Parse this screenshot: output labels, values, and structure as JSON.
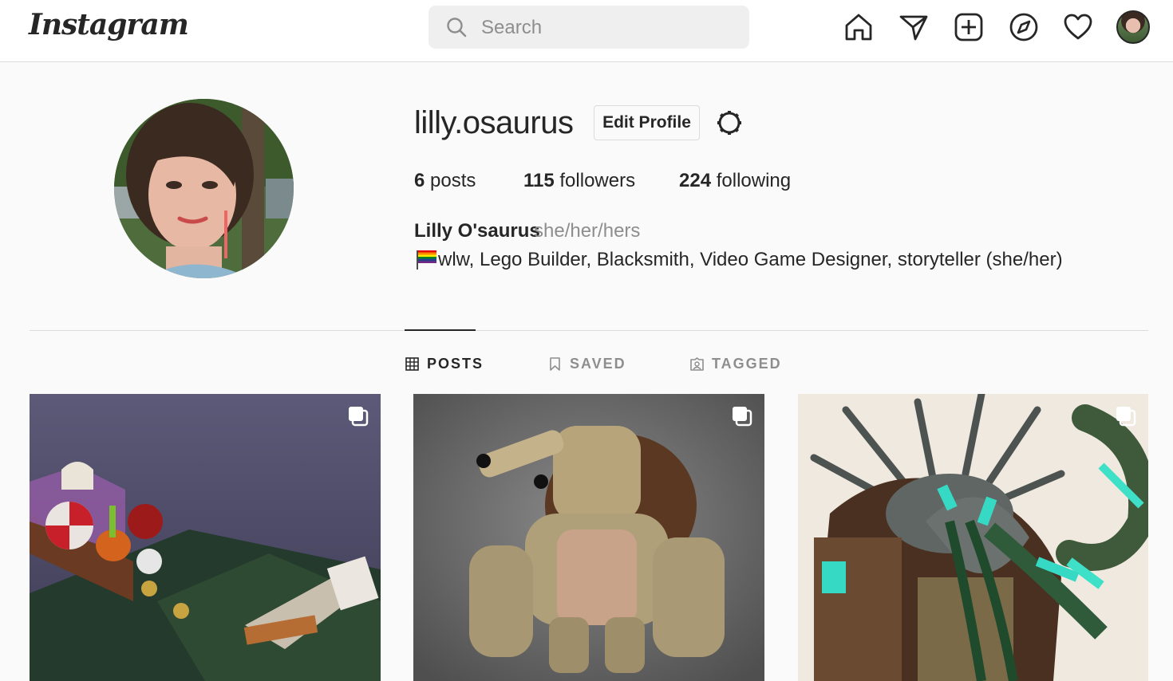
{
  "nav": {
    "logo": "Instagram",
    "search_placeholder": "Search",
    "icons": [
      "home-icon",
      "direct-message-icon",
      "new-post-icon",
      "explore-icon",
      "activity-heart-icon",
      "profile-avatar"
    ]
  },
  "profile": {
    "username": "lilly.osaurus",
    "edit_button": "Edit Profile",
    "stats": {
      "posts_count": "6",
      "posts_label": "posts",
      "followers_count": "115",
      "followers_label": "followers",
      "following_count": "224",
      "following_label": "following"
    },
    "full_name": "Lilly O'saurus",
    "pronouns": "she/her/hers",
    "bio_emoji": "rainbow-flag",
    "bio": "wlw, Lego Builder, Blacksmith, Video Game Designer, storyteller (she/her)"
  },
  "tabs": [
    {
      "label": "POSTS",
      "icon": "grid-icon",
      "active": true
    },
    {
      "label": "SAVED",
      "icon": "bookmark-icon",
      "active": false
    },
    {
      "label": "TAGGED",
      "icon": "tagged-icon",
      "active": false
    }
  ],
  "posts": [
    {
      "subject": "lego-bed-scene",
      "multiple": true
    },
    {
      "subject": "lego-tan-robot-creature",
      "multiple": true
    },
    {
      "subject": "lego-green-cyan-monster",
      "multiple": true
    }
  ],
  "colors": {
    "background": "#fafafa",
    "border": "#dbdbdb",
    "text": "#262626",
    "muted": "#8e8e8e",
    "search_bg": "#efefef"
  }
}
